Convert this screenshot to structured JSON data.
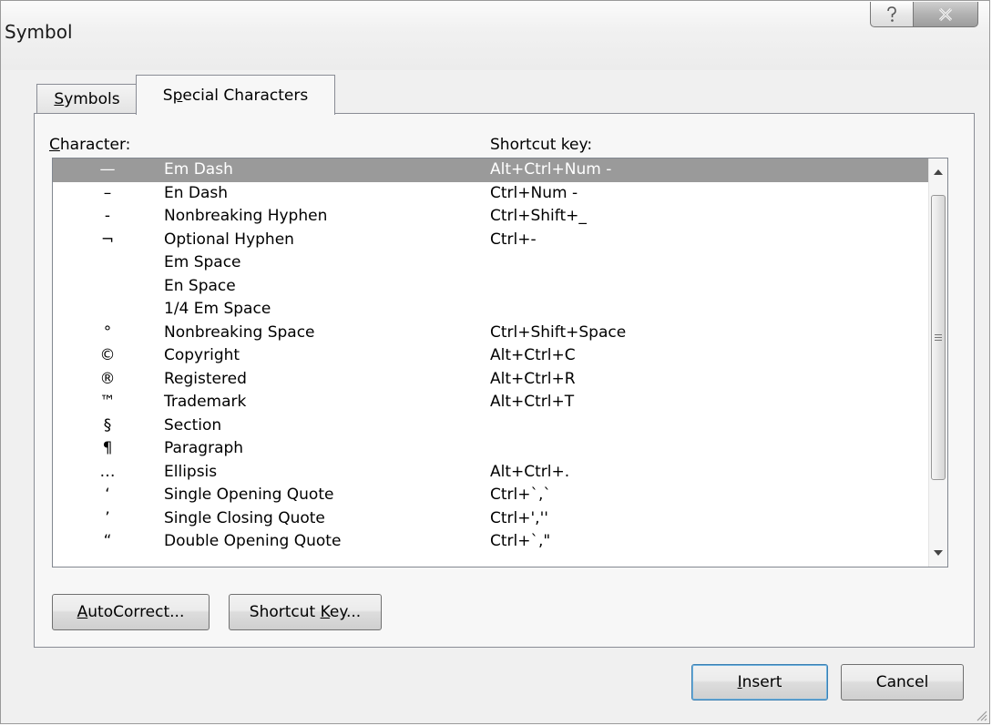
{
  "window": {
    "title": "Symbol"
  },
  "tabs": [
    {
      "label_u": "S",
      "label_rest": "ymbols"
    },
    {
      "label_pre": "S",
      "label_u": "p",
      "label_rest": "ecial Characters"
    }
  ],
  "columns": {
    "character_u": "C",
    "character_rest": "haracter:",
    "shortcut": "Shortcut key:"
  },
  "rows": [
    {
      "char": "—",
      "name": "Em Dash",
      "key": "Alt+Ctrl+Num -"
    },
    {
      "char": "–",
      "name": "En Dash",
      "key": "Ctrl+Num -"
    },
    {
      "char": "-",
      "name": "Nonbreaking Hyphen",
      "key": "Ctrl+Shift+_"
    },
    {
      "char": "¬",
      "name": "Optional Hyphen",
      "key": "Ctrl+-"
    },
    {
      "char": "",
      "name": "Em Space",
      "key": ""
    },
    {
      "char": "",
      "name": "En Space",
      "key": ""
    },
    {
      "char": "",
      "name": "1/4 Em Space",
      "key": ""
    },
    {
      "char": "°",
      "name": "Nonbreaking Space",
      "key": "Ctrl+Shift+Space"
    },
    {
      "char": "©",
      "name": "Copyright",
      "key": "Alt+Ctrl+C"
    },
    {
      "char": "®",
      "name": "Registered",
      "key": "Alt+Ctrl+R"
    },
    {
      "char": "™",
      "name": "Trademark",
      "key": "Alt+Ctrl+T"
    },
    {
      "char": "§",
      "name": "Section",
      "key": ""
    },
    {
      "char": "¶",
      "name": "Paragraph",
      "key": ""
    },
    {
      "char": "…",
      "name": "Ellipsis",
      "key": "Alt+Ctrl+."
    },
    {
      "char": "‘",
      "name": "Single Opening Quote",
      "key": "Ctrl+`,`"
    },
    {
      "char": "’",
      "name": "Single Closing Quote",
      "key": "Ctrl+',''"
    },
    {
      "char": "“",
      "name": "Double Opening Quote",
      "key": "Ctrl+`,\""
    }
  ],
  "buttons": {
    "autocorrect_u": "A",
    "autocorrect_rest": "utoCorrect...",
    "shortcut_pre": "Shortcut ",
    "shortcut_u": "K",
    "shortcut_rest": "ey...",
    "insert_u": "I",
    "insert_rest": "nsert",
    "cancel": "Cancel"
  },
  "selected_row": 0
}
